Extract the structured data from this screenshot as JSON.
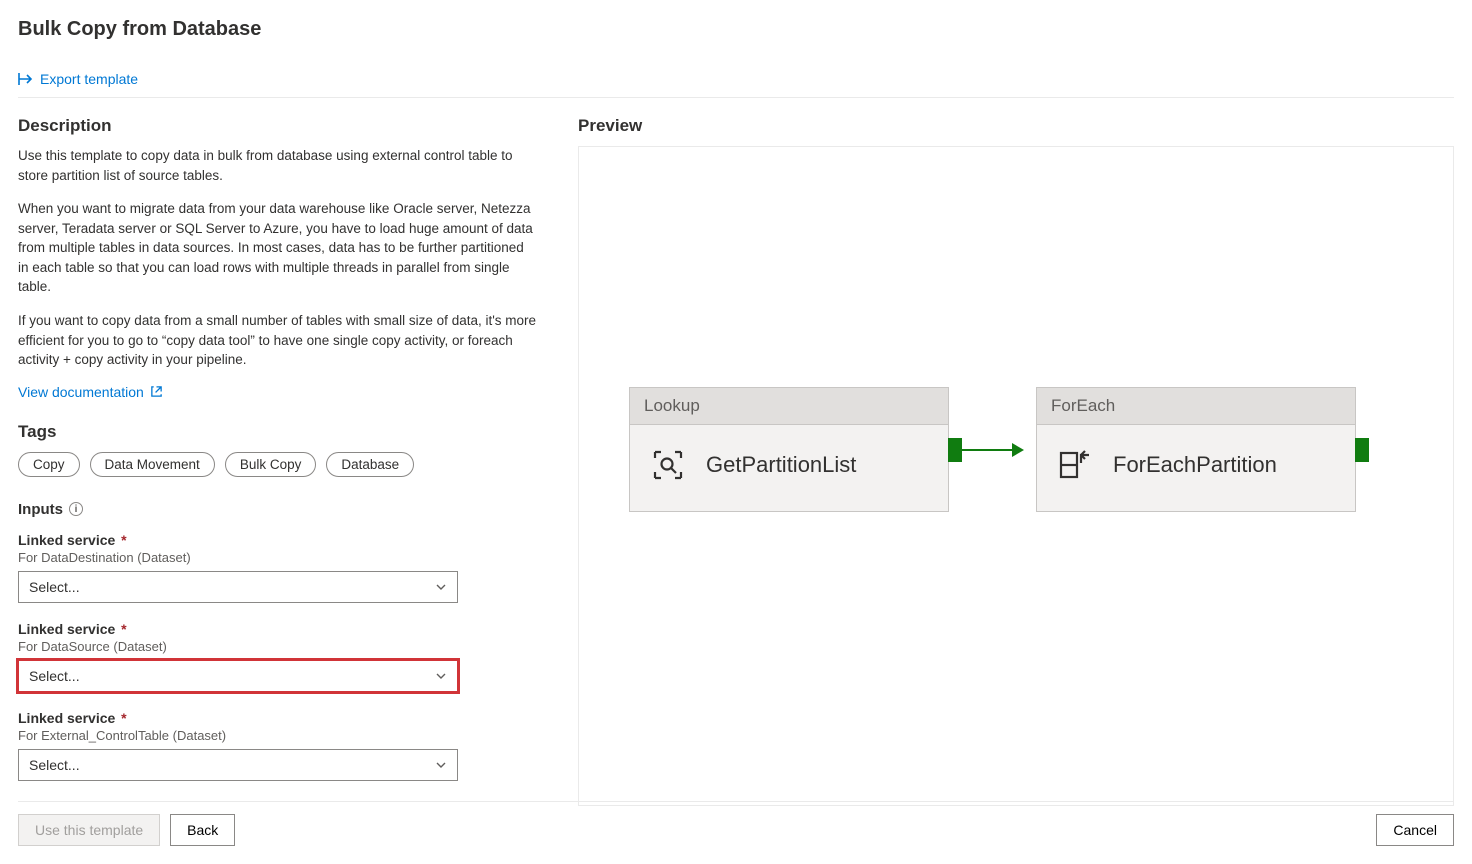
{
  "page_title": "Bulk Copy from Database",
  "toolbar": {
    "export_label": "Export template"
  },
  "description_heading": "Description",
  "description": {
    "p1": "Use this template to copy data in bulk from database using external control table to store partition list of source tables.",
    "p2": "When you want to migrate data from your data warehouse like Oracle server, Netezza server, Teradata server or SQL Server to Azure, you have to load huge amount of data from multiple tables in data sources. In most cases, data has to be further partitioned in each table so that you can load rows with multiple threads in parallel from single table.",
    "p3": "If you want to copy data from a small number of tables with small size of data, it's more efficient for you to go to “copy data tool” to have one single copy activity, or foreach activity + copy activity in your pipeline."
  },
  "doc_link_label": "View documentation",
  "tags_heading": "Tags",
  "tags": [
    "Copy",
    "Data Movement",
    "Bulk Copy",
    "Database"
  ],
  "inputs_heading": "Inputs",
  "required_mark": "*",
  "select_placeholder": "Select...",
  "inputs": [
    {
      "label": "Linked service",
      "sub": "For DataDestination (Dataset)",
      "highlight": false
    },
    {
      "label": "Linked service",
      "sub": "For DataSource (Dataset)",
      "highlight": true
    },
    {
      "label": "Linked service",
      "sub": "For External_ControlTable (Dataset)",
      "highlight": false
    }
  ],
  "preview_heading": "Preview",
  "diagram": {
    "nodes": [
      {
        "type": "Lookup",
        "name": "GetPartitionList",
        "icon": "search-icon"
      },
      {
        "type": "ForEach",
        "name": "ForEachPartition",
        "icon": "foreach-icon"
      }
    ]
  },
  "footer": {
    "use_template": "Use this template",
    "back": "Back",
    "cancel": "Cancel"
  }
}
